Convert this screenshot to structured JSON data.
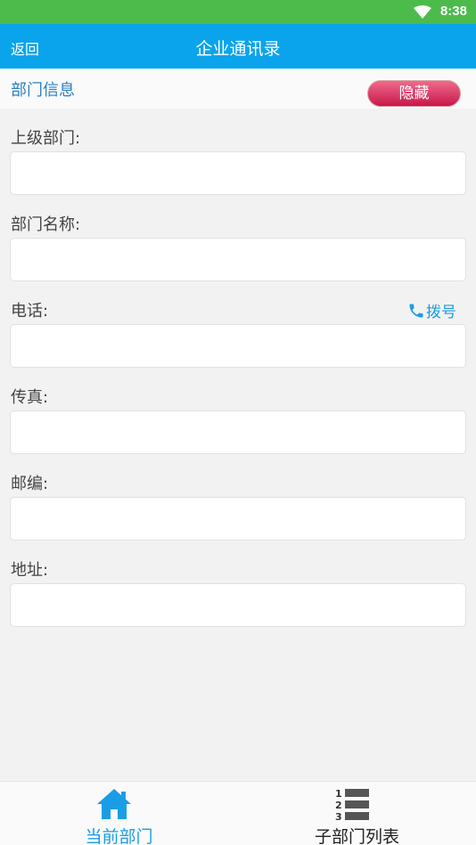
{
  "status_bar": {
    "time": "8:38"
  },
  "header": {
    "back_label": "返回",
    "title": "企业通讯录"
  },
  "section": {
    "title": "部门信息",
    "hide_label": "隐藏"
  },
  "fields": {
    "parent_dept": {
      "label": "上级部门:",
      "value": ""
    },
    "dept_name": {
      "label": "部门名称:",
      "value": ""
    },
    "phone": {
      "label": "电话:",
      "value": "",
      "dial_label": "拨号"
    },
    "fax": {
      "label": "传真:",
      "value": ""
    },
    "postcode": {
      "label": "邮编:",
      "value": ""
    },
    "address": {
      "label": "地址:",
      "value": ""
    }
  },
  "bottom_nav": {
    "current_label": "当前部门",
    "sub_list_label": "子部门列表",
    "list_numbers": [
      "1",
      "2",
      "3"
    ]
  },
  "colors": {
    "status_bar": "#4cbb4c",
    "title_bar": "#0aa4ec",
    "accent": "#1a9de6",
    "hide_button": "#c8174a"
  }
}
